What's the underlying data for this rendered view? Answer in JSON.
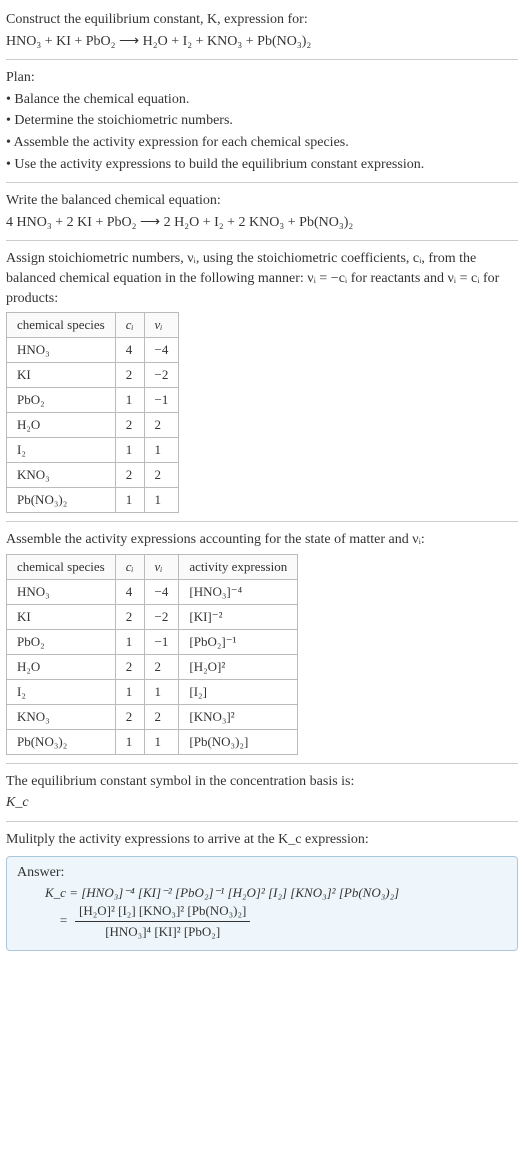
{
  "intro": {
    "line1": "Construct the equilibrium constant, K, expression for:",
    "equation": "HNO₃ + KI + PbO₂ ⟶ H₂O + I₂ + KNO₃ + Pb(NO₃)₂"
  },
  "plan": {
    "heading": "Plan:",
    "items": [
      "Balance the chemical equation.",
      "Determine the stoichiometric numbers.",
      "Assemble the activity expression for each chemical species.",
      "Use the activity expressions to build the equilibrium constant expression."
    ]
  },
  "balanced": {
    "heading": "Write the balanced chemical equation:",
    "equation": "4 HNO₃ + 2 KI + PbO₂ ⟶ 2 H₂O + I₂ + 2 KNO₃ + Pb(NO₃)₂"
  },
  "assign_text": "Assign stoichiometric numbers, νᵢ, using the stoichiometric coefficients, cᵢ, from the balanced chemical equation in the following manner: νᵢ = −cᵢ for reactants and νᵢ = cᵢ for products:",
  "stoich_table": {
    "headers": [
      "chemical species",
      "cᵢ",
      "νᵢ"
    ],
    "rows": [
      {
        "species": "HNO₃",
        "c": "4",
        "v": "−4"
      },
      {
        "species": "KI",
        "c": "2",
        "v": "−2"
      },
      {
        "species": "PbO₂",
        "c": "1",
        "v": "−1"
      },
      {
        "species": "H₂O",
        "c": "2",
        "v": "2"
      },
      {
        "species": "I₂",
        "c": "1",
        "v": "1"
      },
      {
        "species": "KNO₃",
        "c": "2",
        "v": "2"
      },
      {
        "species": "Pb(NO₃)₂",
        "c": "1",
        "v": "1"
      }
    ]
  },
  "assemble_text": "Assemble the activity expressions accounting for the state of matter and νᵢ:",
  "activity_table": {
    "headers": [
      "chemical species",
      "cᵢ",
      "νᵢ",
      "activity expression"
    ],
    "rows": [
      {
        "species": "HNO₃",
        "c": "4",
        "v": "−4",
        "expr": "[HNO₃]⁻⁴"
      },
      {
        "species": "KI",
        "c": "2",
        "v": "−2",
        "expr": "[KI]⁻²"
      },
      {
        "species": "PbO₂",
        "c": "1",
        "v": "−1",
        "expr": "[PbO₂]⁻¹"
      },
      {
        "species": "H₂O",
        "c": "2",
        "v": "2",
        "expr": "[H₂O]²"
      },
      {
        "species": "I₂",
        "c": "1",
        "v": "1",
        "expr": "[I₂]"
      },
      {
        "species": "KNO₃",
        "c": "2",
        "v": "2",
        "expr": "[KNO₃]²"
      },
      {
        "species": "Pb(NO₃)₂",
        "c": "1",
        "v": "1",
        "expr": "[Pb(NO₃)₂]"
      }
    ]
  },
  "eqsym": {
    "line1": "The equilibrium constant symbol in the concentration basis is:",
    "line2": "K_c"
  },
  "mult_text": "Mulitply the activity expressions to arrive at the K_c expression:",
  "answer": {
    "label": "Answer:",
    "kc_flat": "K_c = [HNO₃]⁻⁴ [KI]⁻² [PbO₂]⁻¹ [H₂O]² [I₂] [KNO₃]² [Pb(NO₃)₂]",
    "kc_frac_eq": "=",
    "kc_num": "[H₂O]² [I₂] [KNO₃]² [Pb(NO₃)₂]",
    "kc_den": "[HNO₃]⁴ [KI]² [PbO₂]"
  }
}
